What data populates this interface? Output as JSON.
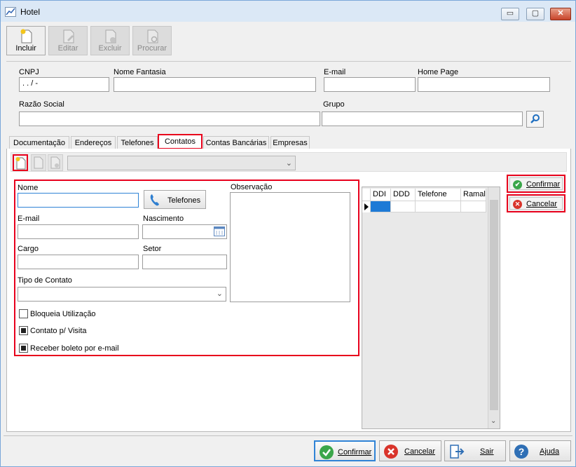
{
  "window": {
    "title": "Hotel",
    "controls": [
      "▭",
      "▢",
      "✕"
    ]
  },
  "toolbar": {
    "incluir": "Incluir",
    "editar": "Editar",
    "excluir": "Excluir",
    "procurar": "Procurar"
  },
  "header": {
    "cnpj_label": "CNPJ",
    "cnpj_value": " .   .   /   -",
    "nome_fantasia_label": "Nome Fantasia",
    "email_label": "E-mail",
    "home_page_label": "Home Page",
    "razao_social_label": "Razão Social",
    "grupo_label": "Grupo"
  },
  "tabs": [
    "Documentação",
    "Endereços",
    "Telefones",
    "Contatos",
    "Contas Bancárias",
    "Empresas"
  ],
  "active_tab": "Contatos",
  "contato_form": {
    "nome_label": "Nome",
    "telefones_button": "Telefones",
    "observacao_label": "Observação",
    "email_label": "E-mail",
    "nascimento_label": "Nascimento",
    "cargo_label": "Cargo",
    "setor_label": "Setor",
    "tipo_contato_label": "Tipo de Contato",
    "bloqueia_label": "Bloqueia Utilização",
    "bloqueia_checked": false,
    "visita_label": "Contato p/ Visita",
    "visita_checked": true,
    "boleto_label": "Receber boleto por e-mail",
    "boleto_checked": true
  },
  "phone_grid": {
    "columns": [
      "DDI",
      "DDD",
      "Telefone",
      "Ramal"
    ]
  },
  "side_actions": {
    "confirmar": "Confirmar",
    "cancelar": "Cancelar"
  },
  "footer": {
    "confirmar": "Confirmar",
    "cancelar": "Cancelar",
    "sair": "Sair",
    "ajuda": "Ajuda"
  },
  "colors": {
    "highlight": "#e8001c",
    "focus_blue": "#2f83d6",
    "title_bar": "#dbe8f6"
  }
}
